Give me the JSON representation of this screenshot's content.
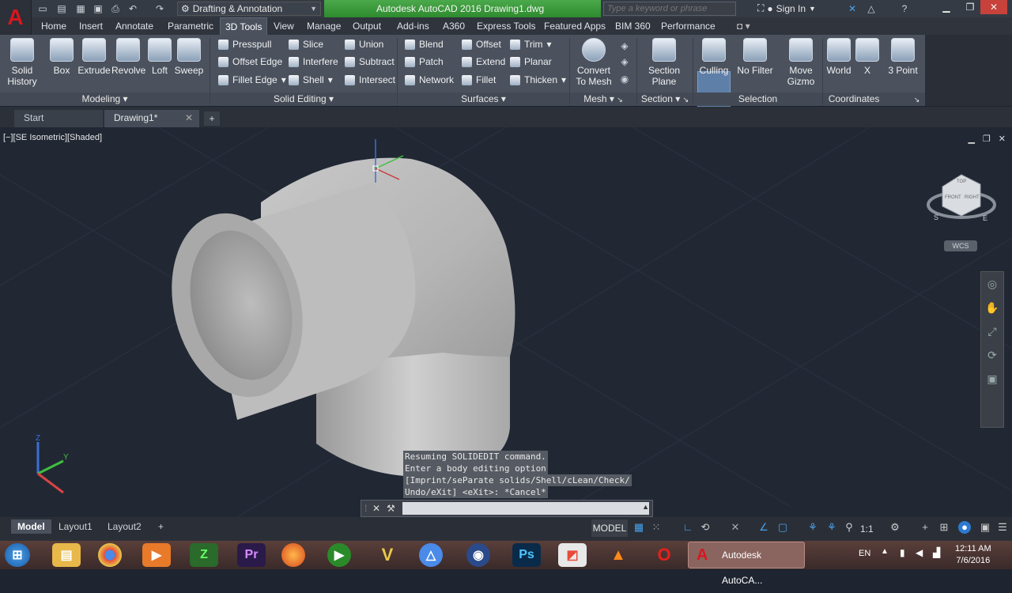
{
  "app": {
    "title": "Autodesk AutoCAD 2016    Drawing1.dwg",
    "logo": "A",
    "workspace": "Drafting & Annotation",
    "search_placeholder": "Type a keyword or phrase",
    "sign_in": "Sign In"
  },
  "ribbon_tabs": [
    "Home",
    "Insert",
    "Annotate",
    "Parametric",
    "3D Tools",
    "View",
    "Manage",
    "Output",
    "Add-ins",
    "A360",
    "Express Tools",
    "Featured Apps",
    "BIM 360",
    "Performance"
  ],
  "active_tab": "3D Tools",
  "panels": {
    "modeling": {
      "title": "Modeling",
      "solid_history": "Solid\nHistory",
      "box": "Box",
      "extrude": "Extrude",
      "revolve": "Revolve",
      "loft": "Loft",
      "sweep": "Sweep"
    },
    "solid_editing": {
      "title": "Solid Editing",
      "presspull": "Presspull",
      "offset_edge": "Offset Edge",
      "fillet_edge": "Fillet Edge",
      "slice": "Slice",
      "interfere": "Interfere",
      "shell": "Shell",
      "union": "Union",
      "subtract": "Subtract",
      "intersect": "Intersect"
    },
    "surfaces": {
      "title": "Surfaces",
      "blend": "Blend",
      "patch": "Patch",
      "network": "Network",
      "offset": "Offset",
      "extend": "Extend",
      "fillet": "Fillet",
      "trim": "Trim",
      "planar": "Planar",
      "thicken": "Thicken"
    },
    "mesh": {
      "title": "Mesh",
      "convert_to_mesh": "Convert\nTo Mesh"
    },
    "section": {
      "title": "Section",
      "section_plane": "Section\nPlane"
    },
    "selection": {
      "title": "Selection",
      "culling": "Culling",
      "no_filter": "No Filter",
      "move_gizmo": "Move\nGizmo"
    },
    "coordinates": {
      "title": "Coordinates",
      "world": "World",
      "x": "X",
      "three_point": "3 Point"
    }
  },
  "doc_tabs": {
    "start": "Start",
    "drawing": "Drawing1*"
  },
  "viewport": {
    "label": "[−][SE Isometric][Shaded]",
    "wcs": "WCS",
    "cube_faces": {
      "top": "TOP",
      "front": "FRONT",
      "right": "RIGHT"
    },
    "compass": {
      "s": "S",
      "e": "E"
    }
  },
  "command": {
    "history": [
      "Resuming SOLIDEDIT command.",
      "Enter a body editing option",
      "[Imprint/seParate solids/Shell/cLean/Check/",
      "Undo/eXit] <eXit>: *Cancel*"
    ],
    "input_placeholder": ""
  },
  "layout_tabs": [
    "Model",
    "Layout1",
    "Layout2"
  ],
  "status": {
    "model": "MODEL",
    "scale": "1:1"
  },
  "taskbar": {
    "active_app": "Autodesk AutoCA...",
    "lang": "EN",
    "time": "12:11 AM",
    "date": "7/6/2016"
  },
  "colors": {
    "title_green": "#3c9b3c",
    "autocad_red": "#d8161e",
    "ribbon_bg": "#4b525e",
    "viewport_bg": "#212834",
    "accent_blue": "#4aa0e8"
  }
}
